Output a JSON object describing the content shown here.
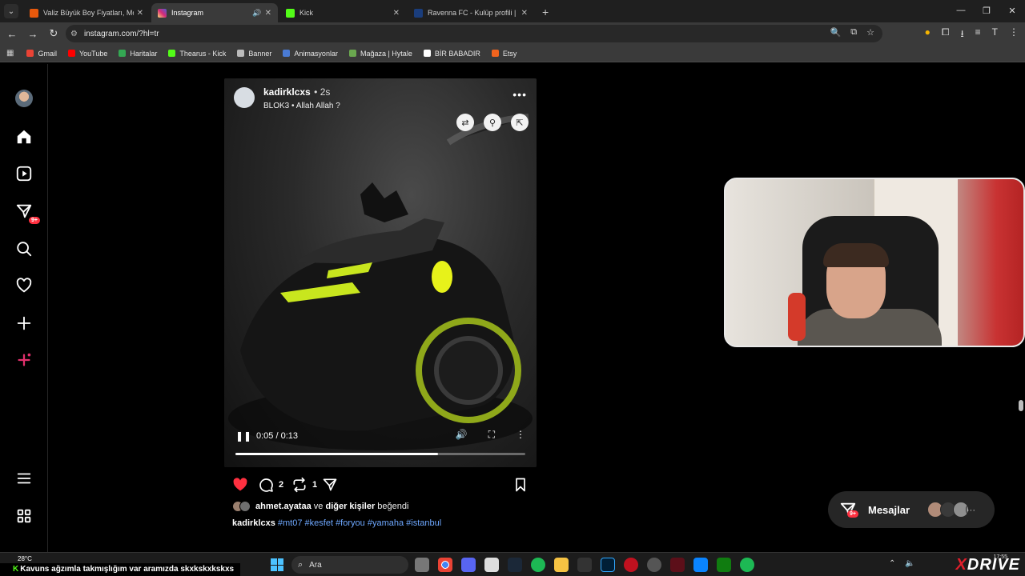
{
  "browser": {
    "tabs": [
      {
        "title": "Valiz Büyük Boy Fiyatları, Modelleri",
        "favicon_color": "#e8590c",
        "active": false,
        "audio": false
      },
      {
        "title": "Instagram",
        "favicon_color": "#d6249f",
        "active": true,
        "audio": true
      },
      {
        "title": "Kick",
        "favicon_color": "#53fc18",
        "active": false,
        "audio": false
      },
      {
        "title": "Ravenna FC - Kulüp profili | Transfermarkt",
        "favicon_color": "#1a3d7c",
        "active": false,
        "audio": false
      }
    ],
    "url": "instagram.com/?hl=tr",
    "bookmarks": [
      {
        "label": "Gmail",
        "color": "#ea4335"
      },
      {
        "label": "YouTube",
        "color": "#ff0000"
      },
      {
        "label": "Haritalar",
        "color": "#34a853"
      },
      {
        "label": "Thearus - Kick",
        "color": "#53fc18"
      },
      {
        "label": "Banner",
        "color": "#bbbbbb"
      },
      {
        "label": "Animasyonlar",
        "color": "#4a7bd4"
      },
      {
        "label": "Mağaza | Hytale",
        "color": "#6aa84f"
      },
      {
        "label": "BİR BABADIR",
        "color": "#ffffff"
      },
      {
        "label": "Etsy",
        "color": "#f1641e"
      }
    ]
  },
  "sidebar": {
    "notifications_badge": "9+"
  },
  "post": {
    "username": "kadirklcxs",
    "time": "• 2s",
    "subtitle": "BLOK3 • Allah Allah ?",
    "video_time": "0:05 / 0:13",
    "progress": 0.7,
    "comments_count": "2",
    "reposts_count": "1",
    "likes": {
      "user": "ahmet.ayataa",
      "connector": "ve",
      "others": "diğer kişiler",
      "verb": "beğendi"
    },
    "caption": {
      "user": "kadirklcxs",
      "hashtags": [
        "#mt07",
        "#kesfet",
        "#foryou",
        "#yamaha",
        "#istanbul"
      ]
    }
  },
  "messages": {
    "label": "Mesajlar",
    "badge": "9+"
  },
  "taskbar": {
    "weather": "28°C",
    "ticker_user": "Kavuns",
    "ticker_text": "ağzımla takmışlığım var aramızda skxkskxkskxs",
    "search_label": "Ara",
    "brand": "DRIVE",
    "clock": "17:55"
  },
  "colors": {
    "accent_like": "#ff3040",
    "hashtag": "#6ea8ff",
    "kick_green": "#53fc18"
  }
}
